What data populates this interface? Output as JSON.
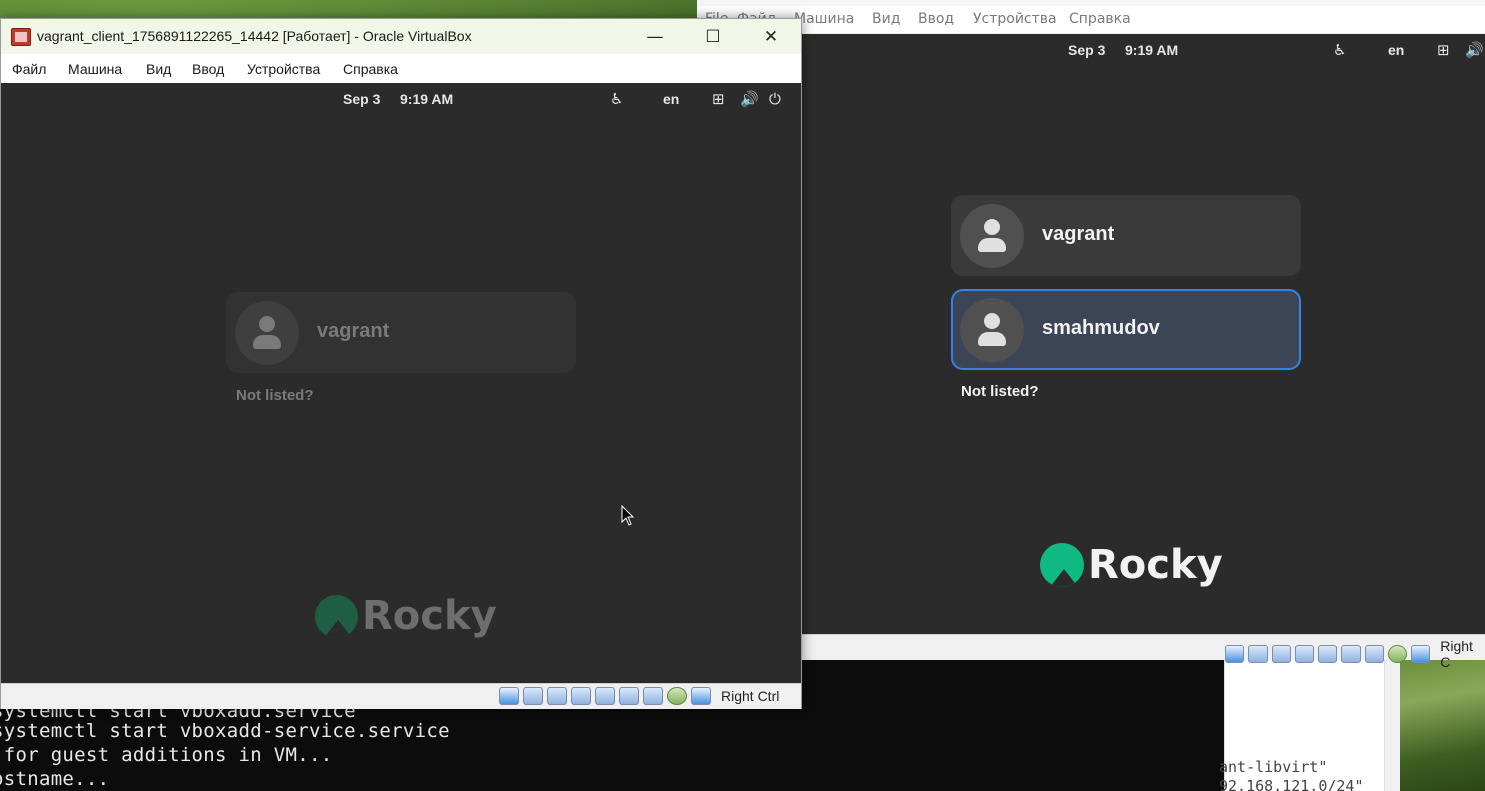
{
  "terminal": {
    "lines": [
      "systemctl start vboxadd.service",
      "systemctl start vboxadd-service.service",
      " for guest additions in VM...",
      "ostname..."
    ]
  },
  "right_panel": {
    "lines": [
      "ant-libvirt\"",
      "92.168.121.0/24\""
    ]
  },
  "window_main": {
    "title": "vagrant_client_1756891122265_14442 [Работает] - Oracle VirtualBox",
    "minimize": "—",
    "maximize": "☐",
    "close": "✕",
    "menu": [
      "Файл",
      "Машина",
      "Вид",
      "Ввод",
      "Устройства",
      "Справка"
    ],
    "gdm": {
      "date": "Sep 3",
      "time": "9:19 AM",
      "lang": "en",
      "users": [
        "vagrant"
      ],
      "not_listed": "Not listed?",
      "brand": "Rocky"
    },
    "status_host_key": "Right Ctrl"
  },
  "window_second": {
    "menu": [
      "File",
      "Файл",
      "Машина",
      "Вид",
      "Ввод",
      "Устройства",
      "Справка"
    ],
    "gdm": {
      "date": "Sep 3",
      "time": "9:19 AM",
      "lang": "en",
      "users": [
        "vagrant",
        "smahmudov"
      ],
      "selected_user": "smahmudov",
      "not_listed": "Not listed?",
      "brand": "Rocky"
    },
    "status_host_key": "Right C"
  },
  "colors": {
    "gdm_bg": "#2b2b2b",
    "card_bg": "#3a3a3a",
    "selected_border": "#3584e4",
    "rocky_green": "#10b981"
  }
}
